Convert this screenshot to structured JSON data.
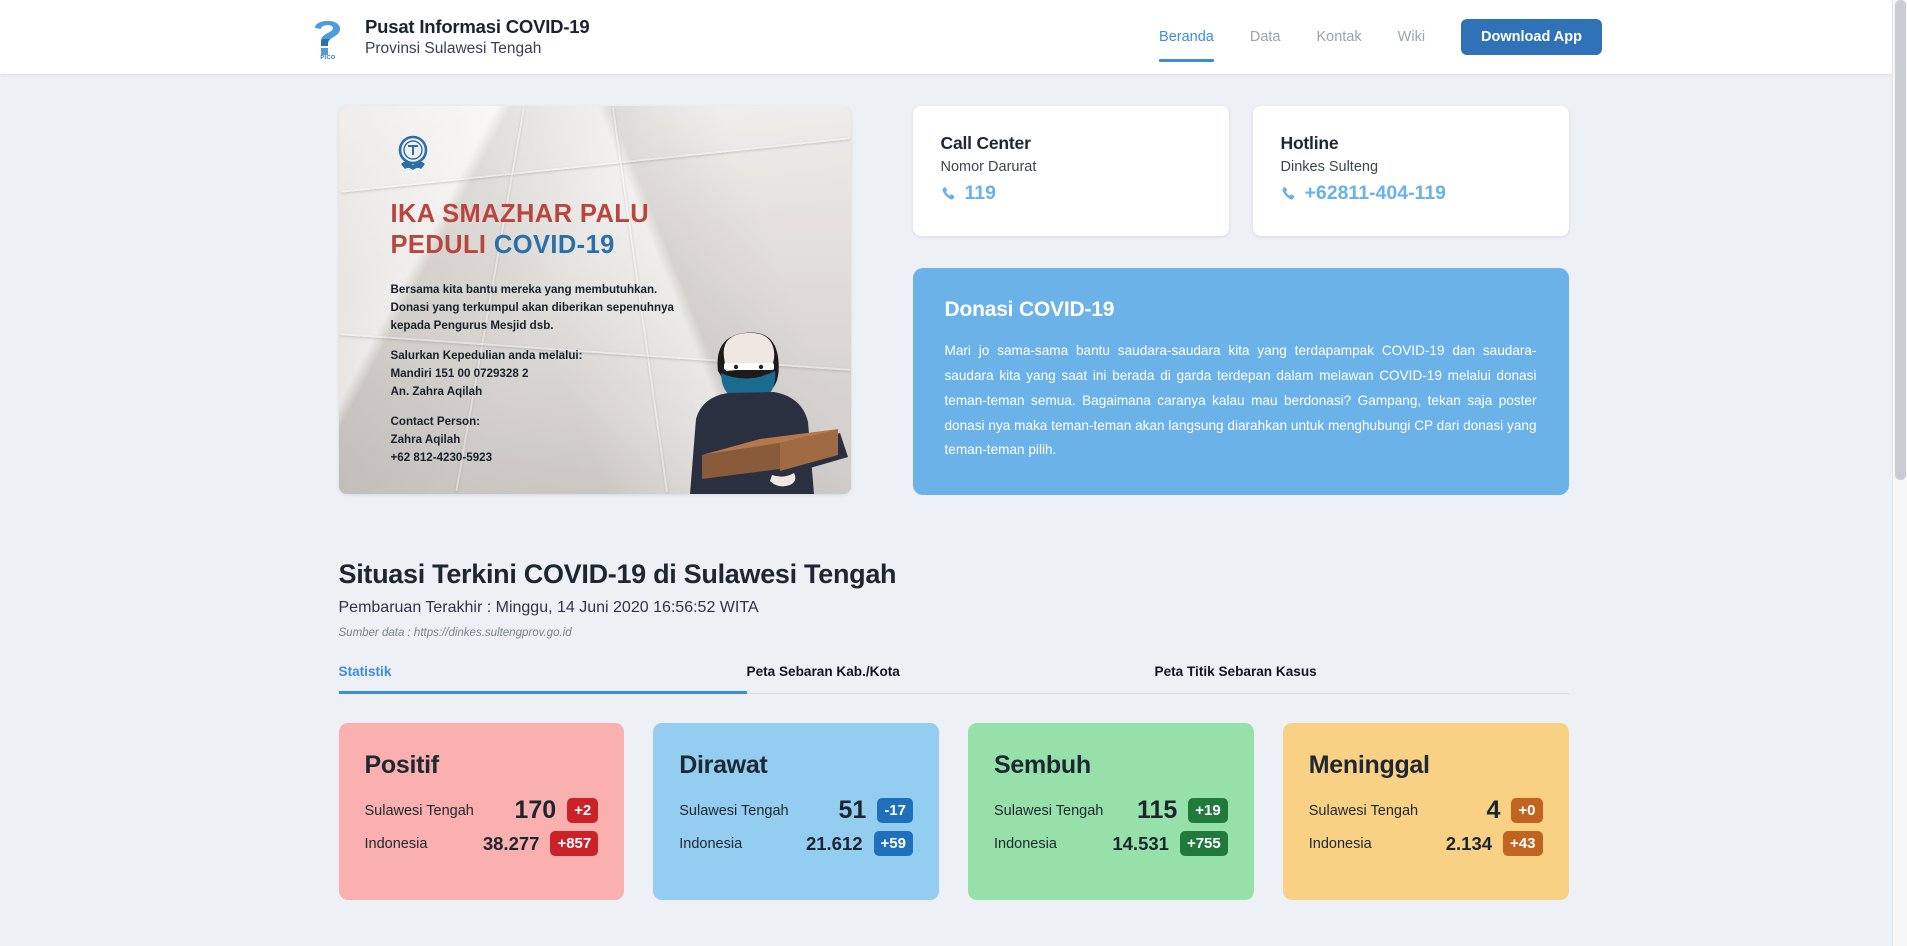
{
  "navbar": {
    "logo_text": "PICO",
    "brand_title": "Pusat Informasi COVID-19",
    "brand_subtitle": "Provinsi Sulawesi Tengah",
    "links": [
      {
        "label": "Beranda",
        "active": true
      },
      {
        "label": "Data",
        "active": false
      },
      {
        "label": "Kontak",
        "active": false
      },
      {
        "label": "Wiki",
        "active": false
      }
    ],
    "download_label": "Download App",
    "accent_color": "#3c8dde",
    "button_color": "#2f72b8"
  },
  "poster": {
    "heading_line1": "IKA SMAZHAR PALU",
    "heading_line2_red": "PEDULI",
    "heading_line2_blue": "COVID-19",
    "paragraph1": "Bersama kita bantu mereka yang membutuhkan. Donasi yang terkumpul akan diberikan sepenuhnya kepada Pengurus Mesjid dsb.",
    "paragraph2": "Salurkan Kepedulian anda melalui: Mandiri 151 00 0729328 2 An. Zahra Aqilah",
    "paragraph3": "Contact Person: Zahra Aqilah +62 812-4230-5923",
    "red_color": "#b8463e",
    "blue_color": "#2b6fa8"
  },
  "contacts": [
    {
      "title": "Call Center",
      "subtitle": "Nomor Darurat",
      "number": "119",
      "icon": "phone-icon"
    },
    {
      "title": "Hotline",
      "subtitle": "Dinkes Sulteng",
      "number": "+62811-404-119",
      "icon": "phone-icon"
    }
  ],
  "donasi": {
    "title": "Donasi COVID-19",
    "text": "Mari jo sama-sama bantu saudara-saudara kita yang terdapampak COVID-19 dan saudara-saudara kita yang saat ini berada di garda terdepan dalam melawan COVID-19 melalui donasi teman-teman semua. Bagaimana caranya kalau mau berdonasi? Gampang, tekan saja poster donasi nya maka teman-teman akan langsung diarahkan untuk menghubungi CP dari donasi yang teman-teman pilih.",
    "bg_color": "#6bb2e8"
  },
  "situasi": {
    "title": "Situasi Terkini COVID-19 di Sulawesi Tengah",
    "subtitle": "Pembaruan Terakhir : Minggu, 14 Juni 2020 16:56:52 WITA",
    "source": "Sumber data : https://dinkes.sultengprov.go.id",
    "tabs": [
      {
        "label": "Statistik",
        "active": true
      },
      {
        "label": "Peta Sebaran Kab./Kota",
        "active": false
      },
      {
        "label": "Peta Titik Sebaran Kasus",
        "active": false
      }
    ]
  },
  "chart_data": {
    "type": "table",
    "title": "Situasi Terkini COVID-19 di Sulawesi Tengah",
    "categories": [
      "Positif",
      "Dirawat",
      "Sembuh",
      "Meninggal"
    ],
    "regions": [
      "Sulawesi Tengah",
      "Indonesia"
    ],
    "series": [
      {
        "name": "Sulawesi Tengah",
        "values": [
          170,
          51,
          115,
          4
        ],
        "deltas": [
          "+2",
          "-17",
          "+19",
          "+0"
        ]
      },
      {
        "name": "Indonesia",
        "values": [
          "38.277",
          "21.612",
          "14.531",
          "2.134"
        ],
        "deltas": [
          "+857",
          "+59",
          "+755",
          "+43"
        ]
      }
    ]
  },
  "stats": [
    {
      "title": "Positif",
      "bg": "#f9b0ae",
      "badge_bg": "#cb2128",
      "rows": [
        {
          "region": "Sulawesi Tengah",
          "value": "170",
          "delta": "+2"
        },
        {
          "region": "Indonesia",
          "value": "38.277",
          "delta": "+857"
        }
      ]
    },
    {
      "title": "Dirawat",
      "bg": "#93cdf0",
      "badge_bg": "#1f6fba",
      "rows": [
        {
          "region": "Sulawesi Tengah",
          "value": "51",
          "delta": "-17"
        },
        {
          "region": "Indonesia",
          "value": "21.612",
          "delta": "+59"
        }
      ]
    },
    {
      "title": "Sembuh",
      "bg": "#96e1a9",
      "badge_bg": "#1f7a3c",
      "rows": [
        {
          "region": "Sulawesi Tengah",
          "value": "115",
          "delta": "+19"
        },
        {
          "region": "Indonesia",
          "value": "14.531",
          "delta": "+755"
        }
      ]
    },
    {
      "title": "Meninggal",
      "bg": "#f9d184",
      "badge_bg": "#c06420",
      "rows": [
        {
          "region": "Sulawesi Tengah",
          "value": "4",
          "delta": "+0"
        },
        {
          "region": "Indonesia",
          "value": "2.134",
          "delta": "+43"
        }
      ]
    }
  ]
}
